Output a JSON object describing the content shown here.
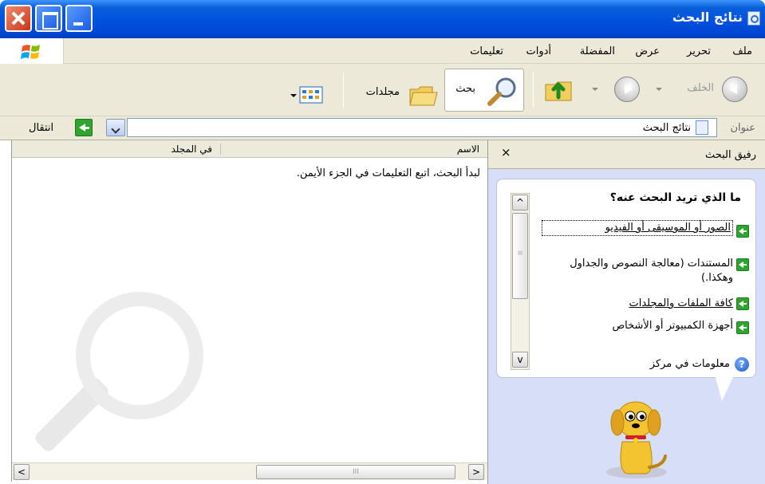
{
  "window": {
    "title": "نتائج البحث"
  },
  "menu": {
    "items": [
      "ملف",
      "تحرير",
      "عرض",
      "المفضلة",
      "أدوات",
      "تعليمات"
    ]
  },
  "toolbar": {
    "back_label": "الخلف",
    "search_label": "بحث",
    "folders_label": "مجلدات"
  },
  "address": {
    "label": "عنوان",
    "value": "نتائج البحث",
    "go_label": "انتقال"
  },
  "results": {
    "columns": [
      "الاسم",
      "في المجلد"
    ],
    "message": "لبدأ البحث، اتبع التعليمات في الجزء الأيمن."
  },
  "companion": {
    "title": "رفيق البحث",
    "close_symbol": "×",
    "question": "ما الذي تريد البحث عنه؟",
    "options": [
      "الصور أو الموسيقى أو الفيديو",
      "المستندات (معالجة النصوص والجداول وهكذا.)",
      "كافة الملفات والمجلدات",
      "أجهزة الكمبيوتر أو الأشخاص",
      "معلومات في مركز"
    ]
  },
  "colors": {
    "titlebar": "#0053e1",
    "chrome": "#ece9d8",
    "companion_bg": "#d6dff7",
    "go_green": "#2fa52f"
  }
}
